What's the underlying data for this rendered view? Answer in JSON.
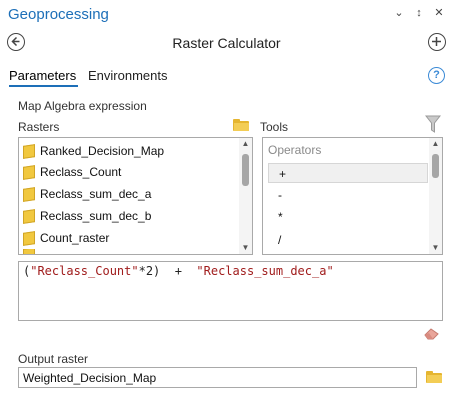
{
  "pane": {
    "title": "Geoprocessing",
    "controls": [
      "⌄",
      "↕",
      "✕"
    ]
  },
  "tool": {
    "title": "Raster Calculator"
  },
  "tabs": [
    {
      "label": "Parameters",
      "active": true
    },
    {
      "label": "Environments",
      "active": false
    }
  ],
  "help_glyph": "?",
  "map_algebra": {
    "label": "Map Algebra expression",
    "rasters_label": "Rasters",
    "tools_label": "Tools",
    "rasters": [
      "Ranked_Decision_Map",
      "Reclass_Count",
      "Reclass_sum_dec_a",
      "Reclass_sum_dec_b",
      "Count_raster"
    ],
    "operators_header": "Operators",
    "operators": [
      "+",
      "-",
      "*",
      "/"
    ],
    "selected_operator": "+",
    "expression": {
      "open": "(",
      "term1": "\"Reclass_Count\"",
      "mid": "*2)  +  ",
      "term2": "\"Reclass_sum_dec_a\""
    }
  },
  "output": {
    "label": "Output raster",
    "value": "Weighted_Decision_Map"
  },
  "colors": {
    "accent": "#1d6fb8",
    "folder": "#e5b530",
    "string_literal": "#a01c1c"
  },
  "icons": [
    "back-icon",
    "add-icon",
    "help-icon",
    "folder-icon",
    "filter-icon",
    "eraser-icon",
    "raster-layer-icon"
  ]
}
